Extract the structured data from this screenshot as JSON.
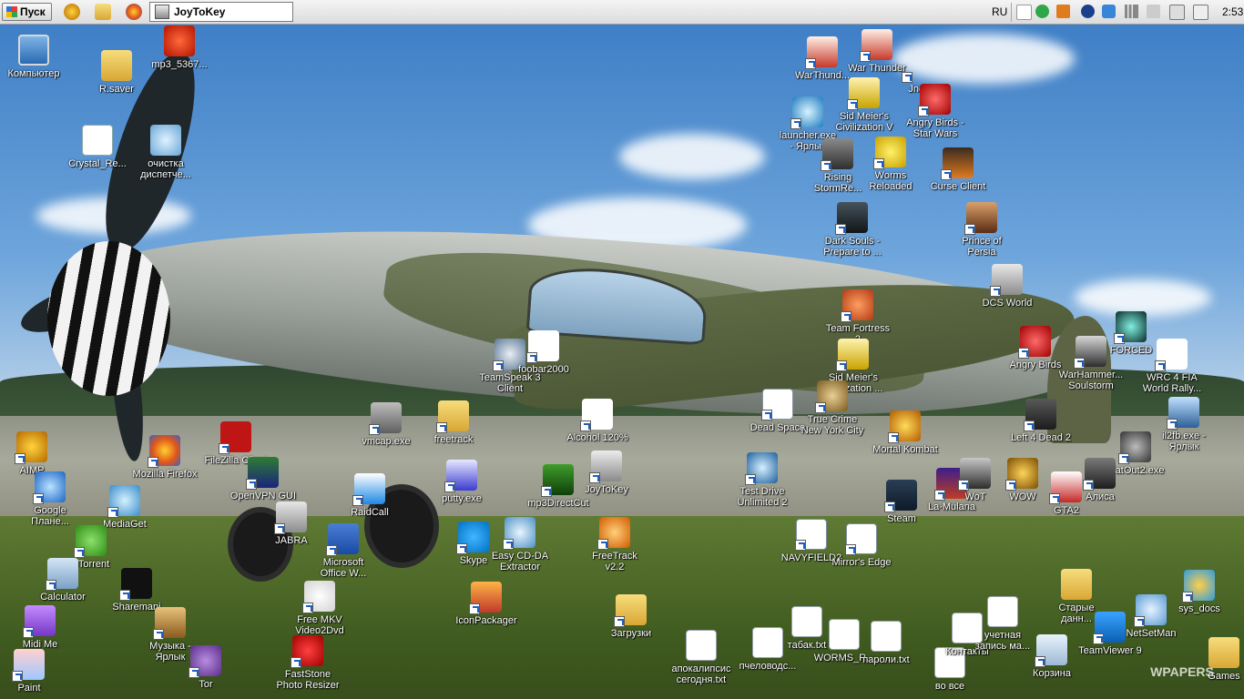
{
  "taskbar": {
    "start_label": "Пуск",
    "active_task": "JoyToKey",
    "language": "RU",
    "clock": "2:53"
  },
  "watermark": "WPAPERS",
  "icons": [
    {
      "label": "Компьютер",
      "icon": "computer-icon"
    },
    {
      "label": "R.saver",
      "icon": "folder-icon"
    },
    {
      "label": "mp3_5367...",
      "icon": "mp3-file-icon"
    },
    {
      "label": "Crystal_Re...",
      "icon": "flash-file-icon"
    },
    {
      "label": "очистка\nдиспетче...",
      "icon": "gear-icon"
    },
    {
      "label": "AIMP",
      "icon": "aimp-icon"
    },
    {
      "label": "Mozilla Firefox",
      "icon": "firefox-icon"
    },
    {
      "label": "Google\nПлане...",
      "icon": "google-earth-icon"
    },
    {
      "label": "MediaGet",
      "icon": "mediaget-icon"
    },
    {
      "label": "uTorrent",
      "icon": "utorrent-icon"
    },
    {
      "label": "Calculator",
      "icon": "calculator-icon"
    },
    {
      "label": "Sharemani",
      "icon": "shareman-icon"
    },
    {
      "label": "Midi Me",
      "icon": "midi-icon"
    },
    {
      "label": "Музыка -\nЯрлык",
      "icon": "music-folder-icon"
    },
    {
      "label": "Paint",
      "icon": "paint-icon"
    },
    {
      "label": "Tor",
      "icon": "tor-icon"
    },
    {
      "label": "FileZilla Client",
      "icon": "filezilla-icon"
    },
    {
      "label": "OpenVPN GUI",
      "icon": "openvpn-icon"
    },
    {
      "label": "JABRA",
      "icon": "jabra-icon"
    },
    {
      "label": "Microsoft\nOffice W...",
      "icon": "word-icon"
    },
    {
      "label": "Free MKV\nVideo2Dvd",
      "icon": "mkv-icon"
    },
    {
      "label": "FastStone\nPhoto Resizer",
      "icon": "faststone-icon"
    },
    {
      "label": "vmcap.exe",
      "icon": "vmcap-icon"
    },
    {
      "label": "RaidCall",
      "icon": "raidcall-icon"
    },
    {
      "label": "freetrack",
      "icon": "folder-icon"
    },
    {
      "label": "putty.exe",
      "icon": "putty-icon"
    },
    {
      "label": "Skype",
      "icon": "skype-icon"
    },
    {
      "label": "TeamSpeak 3\nClient",
      "icon": "teamspeak-icon"
    },
    {
      "label": "foobar2000",
      "icon": "foobar-icon"
    },
    {
      "label": "Alcohol 120%",
      "icon": "alcohol-icon"
    },
    {
      "label": "mp3DirectCut",
      "icon": "mp3directcut-icon"
    },
    {
      "label": "JoyToKey",
      "icon": "joytokey-icon"
    },
    {
      "label": "Easy CD-DA\nExtractor",
      "icon": "cd-icon"
    },
    {
      "label": "IconPackager",
      "icon": "iconpackager-icon"
    },
    {
      "label": "FreeTrack\nv2.2",
      "icon": "freetrack-icon"
    },
    {
      "label": "Загрузки",
      "icon": "downloads-folder-icon"
    },
    {
      "label": "апокалипсис\nсегодня.txt",
      "icon": "text-file-icon"
    },
    {
      "label": "пчеловодс...",
      "icon": "text-file-icon"
    },
    {
      "label": "табак.txt",
      "icon": "text-file-icon"
    },
    {
      "label": "WORMS_R...",
      "icon": "flash-file-icon"
    },
    {
      "label": "пароли.txt",
      "icon": "text-file-icon"
    },
    {
      "label": "во все",
      "icon": "text-file-icon"
    },
    {
      "label": "Контакты",
      "icon": "text-file-icon"
    },
    {
      "label": "учетная\nзапись ма...",
      "icon": "text-file-icon"
    },
    {
      "label": "WarThund...",
      "icon": "warthunder-icon"
    },
    {
      "label": "War Thunder",
      "icon": "warthunder-icon"
    },
    {
      "label": "Jnes",
      "icon": "jnes-icon"
    },
    {
      "label": "Sid Meier's\nCivilization V",
      "icon": "civilization-icon"
    },
    {
      "label": "Angry Birds -\nStar Wars",
      "icon": "angry-birds-icon"
    },
    {
      "label": "launcher.exe\n- Ярлык",
      "icon": "launcher-icon"
    },
    {
      "label": "Rising\nStormRe...",
      "icon": "rising-storm-icon"
    },
    {
      "label": "Worms\nReloaded",
      "icon": "worms-icon"
    },
    {
      "label": "Curse Client",
      "icon": "curse-icon"
    },
    {
      "label": "Dark Souls -\nPrepare to ...",
      "icon": "dark-souls-icon"
    },
    {
      "label": "Prince of\nPersia",
      "icon": "prince-of-persia-icon"
    },
    {
      "label": "DCS World",
      "icon": "dcs-icon"
    },
    {
      "label": "Team Fortress\n2",
      "icon": "tf2-icon"
    },
    {
      "label": "FORCED",
      "icon": "forced-icon"
    },
    {
      "label": "Angry Birds",
      "icon": "angry-birds-icon"
    },
    {
      "label": "WarHammer...\nSoulstorm",
      "icon": "warhammer-icon"
    },
    {
      "label": "WRC 4 FIA\nWorld Rally...",
      "icon": "wrc-icon"
    },
    {
      "label": "Sid Meier's\nCivilization ...",
      "icon": "civilization-icon"
    },
    {
      "label": "il2fb.exe -\nЯрлык",
      "icon": "il2-icon"
    },
    {
      "label": "Dead Space",
      "icon": "dead-space-icon"
    },
    {
      "label": "True Crime\nNew York City",
      "icon": "true-crime-icon"
    },
    {
      "label": "Mortal Kombat",
      "icon": "mortal-kombat-icon"
    },
    {
      "label": "Left 4 Dead 2",
      "icon": "left4dead-icon"
    },
    {
      "label": "FlatOut2.exe",
      "icon": "flatout-icon"
    },
    {
      "label": "Test Drive\nUnlimited 2",
      "icon": "test-drive-icon"
    },
    {
      "label": "Steam",
      "icon": "steam-icon"
    },
    {
      "label": "La-Mulana",
      "icon": "la-mulana-icon"
    },
    {
      "label": "WoT",
      "icon": "wot-icon"
    },
    {
      "label": "WOW",
      "icon": "wow-icon"
    },
    {
      "label": "GTA2",
      "icon": "gta2-icon"
    },
    {
      "label": "Алиса",
      "icon": "alice-icon"
    },
    {
      "label": "NAVYFIELD2",
      "icon": "navyfield-icon"
    },
    {
      "label": "Mirror's Edge",
      "icon": "mirrors-edge-icon"
    },
    {
      "label": "Старые\nданн...",
      "icon": "folder-icon"
    },
    {
      "label": "sys_docs",
      "icon": "sys-docs-icon"
    },
    {
      "label": "NetSetMan",
      "icon": "netsetman-icon"
    },
    {
      "label": "TeamViewer 9",
      "icon": "teamviewer-icon"
    },
    {
      "label": "Корзина",
      "icon": "recycle-bin-icon"
    },
    {
      "label": "Games",
      "icon": "folder-icon"
    }
  ]
}
